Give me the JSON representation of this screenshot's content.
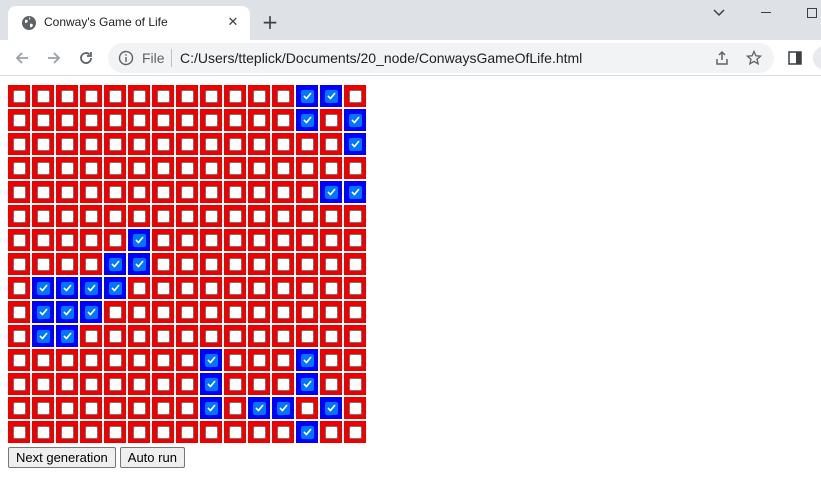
{
  "browser": {
    "tab": {
      "title": "Conway's Game of Life",
      "favicon": "globe-icon"
    },
    "omnibox": {
      "scheme_label": "File",
      "url": "C:/Users/tteplick/Documents/20_node/ConwaysGameOfLife.html"
    },
    "toolbar_icons": [
      "back-arrow-icon",
      "forward-arrow-icon",
      "reload-icon",
      "info-icon",
      "share-icon",
      "star-icon",
      "side-panel-icon"
    ]
  },
  "game": {
    "rows": 15,
    "cols": 15,
    "dead_color": "#ee0000",
    "alive_color": "#0000ff",
    "alive_cells": [
      [
        0,
        12
      ],
      [
        0,
        13
      ],
      [
        1,
        12
      ],
      [
        1,
        14
      ],
      [
        2,
        14
      ],
      [
        4,
        13
      ],
      [
        4,
        14
      ],
      [
        6,
        5
      ],
      [
        7,
        4
      ],
      [
        7,
        5
      ],
      [
        8,
        1
      ],
      [
        8,
        2
      ],
      [
        8,
        3
      ],
      [
        8,
        4
      ],
      [
        9,
        1
      ],
      [
        9,
        2
      ],
      [
        9,
        3
      ],
      [
        10,
        1
      ],
      [
        10,
        2
      ],
      [
        11,
        8
      ],
      [
        11,
        12
      ],
      [
        12,
        8
      ],
      [
        12,
        12
      ],
      [
        13,
        8
      ],
      [
        13,
        10
      ],
      [
        13,
        11
      ],
      [
        13,
        13
      ],
      [
        14,
        12
      ]
    ]
  },
  "buttons": {
    "next_generation": "Next generation",
    "auto_run": "Auto run"
  }
}
